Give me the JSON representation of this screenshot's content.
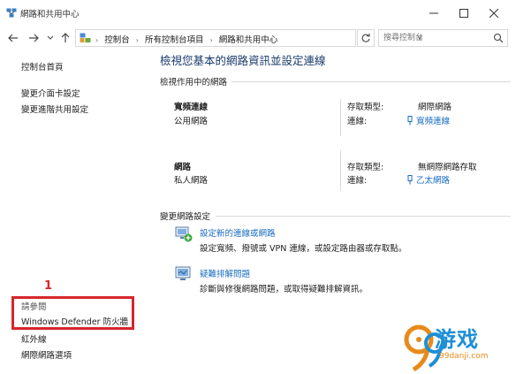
{
  "window": {
    "title": "網路和共用中心"
  },
  "nav": {
    "breadcrumbs": [
      "控制台",
      "所有控制台項目",
      "網路和共用中心"
    ],
    "search_placeholder": "搜尋控制台"
  },
  "sidebar": {
    "items": [
      {
        "label": "控制台首頁"
      },
      {
        "label": "變更介面卡設定"
      },
      {
        "label": "變更進階共用設定"
      }
    ],
    "see_also_label": "請參閱",
    "see_also": [
      {
        "label": "Windows Defender 防火牆"
      },
      {
        "label": "紅外線"
      },
      {
        "label": "網際網路選項"
      }
    ]
  },
  "main": {
    "title": "檢視您基本的網路資訊並設定連線",
    "active_networks_header": "檢視作用中的網路",
    "access_type_label": "存取類型:",
    "connections_label": "連線:",
    "networks": [
      {
        "name": "寬頻連線",
        "type": "公用網路",
        "access_type": "網際網路",
        "connection": "寬頻連線"
      },
      {
        "name": "網路",
        "type": "私人網路",
        "access_type": "無網際網路存取",
        "connection": "乙太網路"
      }
    ],
    "change_settings_header": "變更網路設定",
    "tasks": [
      {
        "link": "設定新的連線或網路",
        "desc": "設定寬頻、撥號或 VPN 連線，或設定路由器或存取點。"
      },
      {
        "link": "疑難排解問題",
        "desc": "診斷與修復網路問題，或取得疑難排解資訊。"
      }
    ]
  },
  "annotation": {
    "marker": "1",
    "color": "#d6262c"
  },
  "watermark": {
    "text": "游戏",
    "url": "99danji.com"
  },
  "colors": {
    "link": "#1a6cc2",
    "title": "#1a3a6b"
  }
}
